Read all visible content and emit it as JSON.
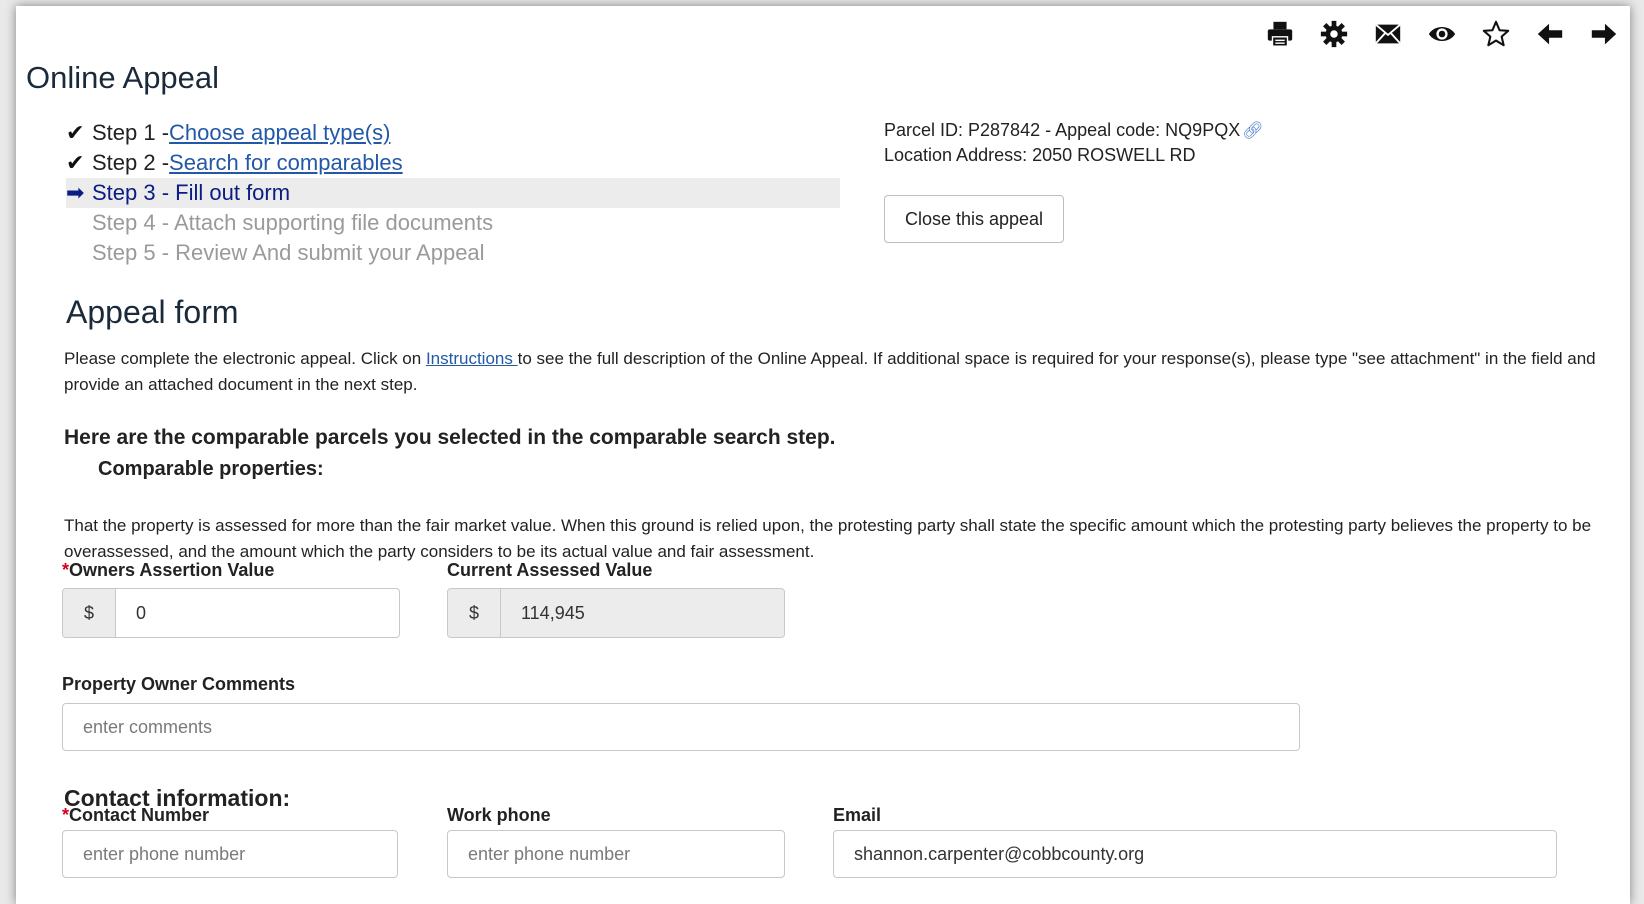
{
  "toolbar": {
    "icons": [
      "print-icon",
      "gear-icon",
      "envelope-icon",
      "eye-icon",
      "star-icon",
      "arrow-left-icon",
      "arrow-right-icon"
    ]
  },
  "page_title": "Online Appeal",
  "steps": [
    {
      "prefix": "Step 1 - ",
      "link": "Choose appeal type(s)",
      "state": "done"
    },
    {
      "prefix": "Step 2 - ",
      "link": "Search for comparables",
      "state": "done"
    },
    {
      "prefix": "Step 3 - Fill out form",
      "link": "",
      "state": "current"
    },
    {
      "prefix": "Step 4 - Attach supporting file documents",
      "link": "",
      "state": "disabled"
    },
    {
      "prefix": "Step 5 - Review And submit your Appeal",
      "link": "",
      "state": "disabled"
    }
  ],
  "parcel": {
    "line1": "Parcel ID: P287842 - Appeal code: NQ9PQX",
    "line2": "Location Address: 2050 ROSWELL RD"
  },
  "close_button": "Close this appeal",
  "form_title": "Appeal form",
  "intro": {
    "before": "Please complete the electronic appeal. Click on ",
    "link": "Instructions ",
    "after": "to see the full description of the Online Appeal. If additional space is required for your response(s), please type \"see attachment\" in the field and provide an attached document in the next step."
  },
  "comparables": {
    "heading": "Here are the comparable parcels you selected in the comparable search step.",
    "subheading": "Comparable properties:"
  },
  "ground_text": "That the property is assessed for more than the fair market value. When this ground is relied upon, the protesting party shall state the specific amount which the protesting party believes the property to be overassessed, and the amount which the party considers to be its actual value and fair assessment.",
  "fields": {
    "owners_assertion": {
      "label": "Owners Assertion Value",
      "required": "*",
      "currency": "$",
      "value": "0"
    },
    "current_assessed": {
      "label": "Current Assessed Value",
      "currency": "$",
      "value": "114,945"
    },
    "comments": {
      "label": "Property Owner Comments",
      "placeholder": "enter comments"
    }
  },
  "contact": {
    "heading": "Contact information:",
    "contact_number": {
      "label": "Contact Number",
      "required": "*",
      "placeholder": "enter phone number"
    },
    "work_phone": {
      "label": "Work phone",
      "placeholder": "enter phone number"
    },
    "email": {
      "label": "Email",
      "value": "shannon.carpenter@cobbcounty.org"
    }
  }
}
